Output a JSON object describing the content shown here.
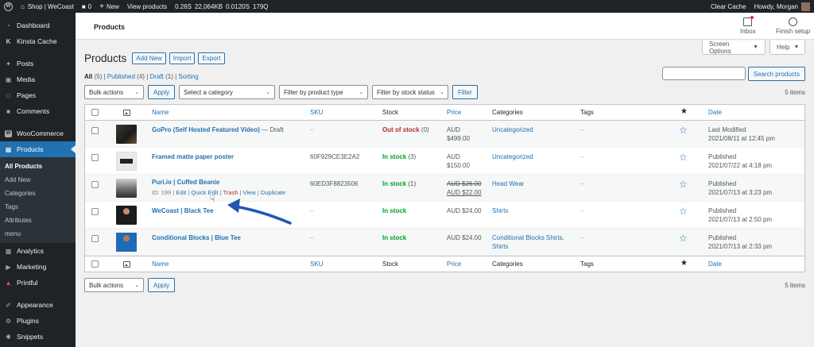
{
  "adminbar": {
    "site_name": "Shop | WeCoast",
    "comments_count": "0",
    "new_label": "New",
    "view_products": "View products",
    "metric_time": "0.26S",
    "metric_mem": "22,064KB",
    "metric_query_time": "0.0120S",
    "metric_queries": "179Q",
    "clear_cache": "Clear Cache",
    "howdy": "Howdy, Morgan"
  },
  "sidebar": {
    "items": [
      {
        "label": "Dashboard",
        "icon": "dashboard-icon"
      },
      {
        "label": "Kinsta Cache",
        "icon": "kinsta-icon"
      },
      {
        "label": "Posts",
        "icon": "pin-icon"
      },
      {
        "label": "Media",
        "icon": "media-icon"
      },
      {
        "label": "Pages",
        "icon": "page-icon"
      },
      {
        "label": "Comments",
        "icon": "comment-icon"
      },
      {
        "label": "WooCommerce",
        "icon": "woo-icon"
      },
      {
        "label": "Products",
        "icon": "archive-icon"
      },
      {
        "label": "Analytics",
        "icon": "chart-icon"
      },
      {
        "label": "Marketing",
        "icon": "megaphone-icon"
      },
      {
        "label": "Printful",
        "icon": "printful-icon"
      },
      {
        "label": "Appearance",
        "icon": "brush-icon"
      },
      {
        "label": "Plugins",
        "icon": "plugin-icon"
      },
      {
        "label": "Snippets",
        "icon": "snippet-icon"
      }
    ],
    "submenu": [
      "All Products",
      "Add New",
      "Categories",
      "Tags",
      "Attributes",
      "menu"
    ]
  },
  "header": {
    "title": "Products",
    "inbox": "Inbox",
    "finish_setup": "Finish setup"
  },
  "screen_options": "Screen Options",
  "help": "Help",
  "page": {
    "title": "Products",
    "add_new": "Add New",
    "import": "Import",
    "export": "Export"
  },
  "filters": {
    "all": "All",
    "all_count": "(5)",
    "published": "Published",
    "published_count": "(4)",
    "draft": "Draft",
    "draft_count": "(1)",
    "sorting": "Sorting",
    "sep": "|"
  },
  "search": {
    "button": "Search products"
  },
  "tablenav": {
    "bulk_actions": "Bulk actions",
    "apply": "Apply",
    "category": "Select a category",
    "product_type": "Filter by product type",
    "stock_status": "Filter by stock status",
    "filter": "Filter",
    "items": "5 items"
  },
  "columns": {
    "name": "Name",
    "sku": "SKU",
    "stock": "Stock",
    "price": "Price",
    "categories": "Categories",
    "tags": "Tags",
    "date": "Date"
  },
  "rows": [
    {
      "name": "GoPro (Self Hosted Featured Video)",
      "suffix": "— Draft",
      "sku": "–",
      "stock": "Out of stock",
      "stock_qty": "(0)",
      "price1": "AUD",
      "price2": "$499.00",
      "category": "Uncategorized",
      "category2": "",
      "tags": "–",
      "date_status": "Last Modified",
      "date": "2021/08/11 at 12:45 pm"
    },
    {
      "name": "Framed matte paper poster",
      "suffix": "",
      "sku": "60F929CE3E2A2",
      "stock": "In stock",
      "stock_qty": "(3)",
      "price1": "AUD",
      "price2": "$150.00",
      "category": "Uncategorized",
      "category2": "",
      "tags": "–",
      "date_status": "Published",
      "date": "2021/07/22 at 4:18 pm"
    },
    {
      "name": "Puri.io | Cuffed Beanie",
      "suffix": "",
      "sku": "60ED3F8823506",
      "stock": "In stock",
      "stock_qty": "(1)",
      "price1": "AUD $26.00",
      "price2": "AUD $22.00",
      "category": "Head Wear",
      "category2": "",
      "tags": "–",
      "date_status": "Published",
      "date": "2021/07/13 at 3:23 pm",
      "row_actions": {
        "id": "ID: 199",
        "edit": "Edit",
        "quick_edit": "Quick Edit",
        "trash": "Trash",
        "view": "View",
        "duplicate": "Duplicate",
        "sep": "|"
      }
    },
    {
      "name": "WeCoast | Black Tee",
      "suffix": "",
      "sku": "–",
      "stock": "In stock",
      "stock_qty": "",
      "price1": "AUD $24.00",
      "price2": "",
      "category": "Shirts",
      "category2": "",
      "tags": "–",
      "date_status": "Published",
      "date": "2021/07/13 at 2:50 pm"
    },
    {
      "name": "Conditional Blocks | Blue Tee",
      "suffix": "",
      "sku": "–",
      "stock": "In stock",
      "stock_qty": "",
      "price1": "AUD $24.00",
      "price2": "",
      "category": "Conditional Blocks Shirts,",
      "category2": "Shirts",
      "tags": "–",
      "date_status": "Published",
      "date": "2021/07/13 at 2:33 pm"
    }
  ],
  "colors": {
    "accent": "#2271b1",
    "sidebar": "#1d2327",
    "in_stock": "#00a32a",
    "out_of_stock": "#b32d2e"
  }
}
